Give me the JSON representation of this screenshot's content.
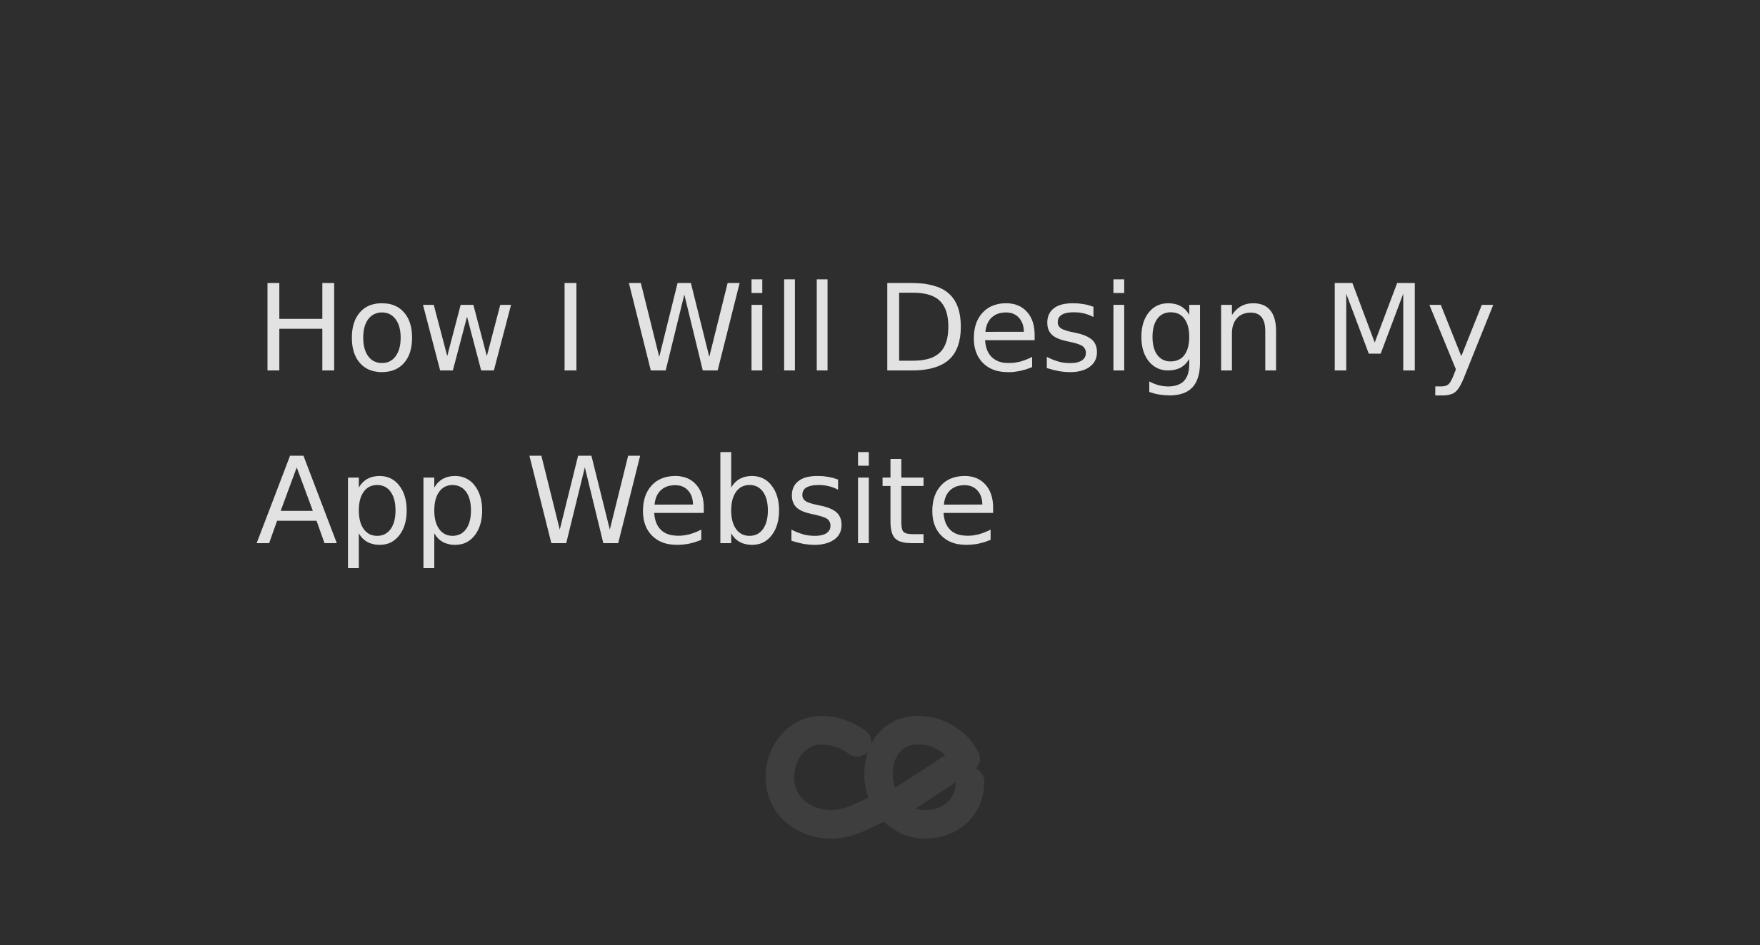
{
  "title": {
    "line1": "How I Will Design My",
    "line2": "App Website"
  },
  "logo": {
    "icon": "ce-logo-icon",
    "color": "#3e3e3e"
  },
  "colors": {
    "background": "#2e2e2e",
    "text": "#e2e2e2"
  }
}
